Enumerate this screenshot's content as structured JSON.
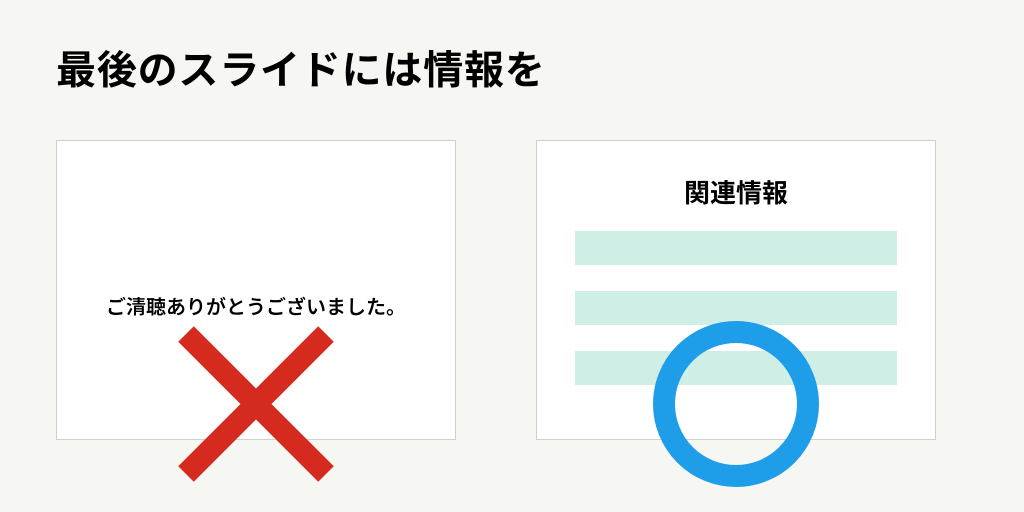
{
  "title": "最後のスライドには情報を",
  "bad_example": {
    "text": "ご清聴ありがとうございました。"
  },
  "good_example": {
    "heading": "関連情報"
  },
  "colors": {
    "cross": "#d52b1e",
    "circle": "#1e9ee8",
    "bar": "#cfeee6",
    "bg": "#f6f6f3"
  }
}
